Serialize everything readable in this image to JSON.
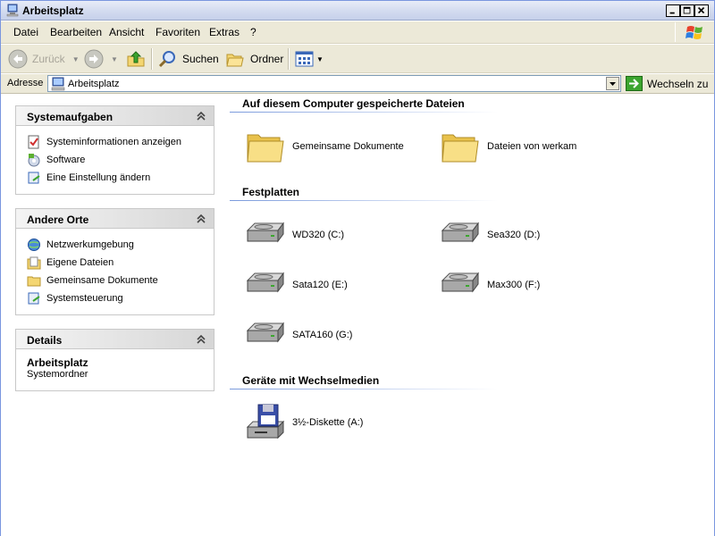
{
  "window": {
    "title": "Arbeitsplatz"
  },
  "menu": [
    "Datei",
    "Bearbeiten",
    "Ansicht",
    "Favoriten",
    "Extras",
    "?"
  ],
  "toolbar": {
    "back": "Zurück",
    "search": "Suchen",
    "folders": "Ordner"
  },
  "address": {
    "label": "Adresse",
    "value": "Arbeitsplatz",
    "go": "Wechseln zu"
  },
  "panels": {
    "system_tasks": {
      "title": "Systemaufgaben",
      "items": [
        "Systeminformationen anzeigen",
        "Software",
        "Eine Einstellung ändern"
      ]
    },
    "other_places": {
      "title": "Andere Orte",
      "items": [
        "Netzwerkumgebung",
        "Eigene Dateien",
        "Gemeinsame Dokumente",
        "Systemsteuerung"
      ]
    },
    "details": {
      "title": "Details",
      "name": "Arbeitsplatz",
      "type": "Systemordner"
    }
  },
  "sections": {
    "stored": {
      "title": "Auf diesem Computer gespeicherte Dateien",
      "items": [
        "Gemeinsame Dokumente",
        "Dateien von werkam"
      ]
    },
    "drives": {
      "title": "Festplatten",
      "items": [
        "WD320 (C:)",
        "Sea320 (D:)",
        "Sata120 (E:)",
        "Max300 (F:)",
        "SATA160 (G:)"
      ]
    },
    "removable": {
      "title": "Geräte mit Wechselmedien",
      "items": [
        "3½-Diskette (A:)"
      ]
    }
  },
  "colors": {
    "accent": "#7a96df",
    "panel_header": "#d6d6d6",
    "chrome": "#ece9d8"
  }
}
